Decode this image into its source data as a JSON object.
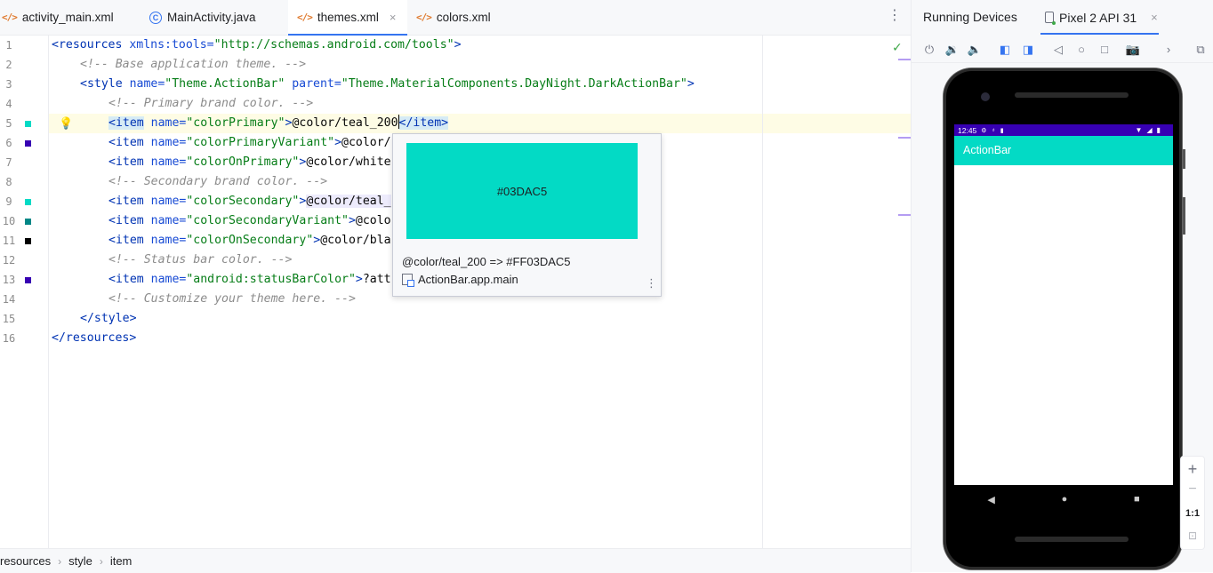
{
  "tabs": [
    {
      "label": "activity_main.xml",
      "icon": "xml-icon",
      "active": false
    },
    {
      "label": "MainActivity.java",
      "icon": "java-class-icon",
      "active": false
    },
    {
      "label": "themes.xml",
      "icon": "xml-icon",
      "active": true,
      "close": "×"
    },
    {
      "label": "colors.xml",
      "icon": "xml-icon",
      "active": false
    }
  ],
  "tab_more": "⋮",
  "editor": {
    "line_numbers": [
      "1",
      "2",
      "3",
      "4",
      "5",
      "6",
      "7",
      "8",
      "9",
      "10",
      "11",
      "12",
      "13",
      "14",
      "15",
      "16"
    ],
    "gutter_swatches": [
      {
        "line": 5,
        "color": "#03DAC5"
      },
      {
        "line": 6,
        "color": "#3700B3"
      },
      {
        "line": 9,
        "color": "#03DAC5"
      },
      {
        "line": 10,
        "color": "#018786"
      },
      {
        "line": 11,
        "color": "#000000"
      },
      {
        "line": 13,
        "color": "#3700B3"
      }
    ],
    "lines": {
      "l1": {
        "open": "<resources",
        "attr": " xmlns:tools=",
        "val": "\"http://schemas.android.com/tools\"",
        "close": ">"
      },
      "l2": {
        "comment": "<!-- Base application theme. -->"
      },
      "l3": {
        "open": "<style",
        "attr1": " name=",
        "val1": "\"Theme.ActionBar\"",
        "attr2": " parent=",
        "val2": "\"Theme.MaterialComponents.DayNight.DarkActionBar\"",
        "close": ">"
      },
      "l4": {
        "comment": "<!-- Primary brand color. -->"
      },
      "l5": {
        "open": "<item",
        "attr": " name=",
        "val": "\"colorPrimary\"",
        "gt": ">",
        "text": "@color/teal_200",
        "end": "</item>"
      },
      "l6": {
        "open": "<item",
        "attr": " name=",
        "val": "\"colorPrimaryVariant\"",
        "gt": ">",
        "text": "@color/"
      },
      "l7": {
        "open": "<item",
        "attr": " name=",
        "val": "\"colorOnPrimary\"",
        "gt": ">",
        "text": "@color/white"
      },
      "l8": {
        "comment": "<!-- Secondary brand color. -->"
      },
      "l9": {
        "open": "<item",
        "attr": " name=",
        "val": "\"colorSecondary\"",
        "gt": ">",
        "text": "@color/teal_"
      },
      "l10": {
        "open": "<item",
        "attr": " name=",
        "val": "\"colorSecondaryVariant\"",
        "gt": ">",
        "text": "@colo"
      },
      "l11": {
        "open": "<item",
        "attr": " name=",
        "val": "\"colorOnSecondary\"",
        "gt": ">",
        "text": "@color/bla"
      },
      "l12": {
        "comment": "<!-- Status bar color. -->"
      },
      "l13": {
        "open": "<item",
        "attr": " name=",
        "val": "\"android:statusBarColor\"",
        "gt": ">",
        "text": "?att"
      },
      "l14": {
        "comment": "<!-- Customize your theme here. -->"
      },
      "l15": {
        "end": "</style>"
      },
      "l16": {
        "end": "</resources>"
      }
    }
  },
  "popup": {
    "swatch_color": "#03DAC5",
    "swatch_label": "#03DAC5",
    "value_text": "@color/teal_200 => #FF03DAC5",
    "module": "ActionBar.app.main",
    "more": "⋮"
  },
  "breadcrumb": [
    "resources",
    "style",
    "item"
  ],
  "breadcrumb_sep": "›",
  "running_devices": {
    "title": "Running Devices",
    "device_tab": "Pixel 2 API 31",
    "close": "×",
    "toolbar_icons": [
      "power-icon",
      "volume-up-icon",
      "volume-down-icon",
      "rotate-left-icon",
      "rotate-right-icon",
      "back-icon",
      "home-icon",
      "overview-icon",
      "screenshot-icon",
      "more-icon",
      "device-frame-icon"
    ]
  },
  "phone": {
    "status_time": "12:45",
    "app_title": "ActionBar",
    "actionbar_color": "#03DAC5",
    "statusbar_color": "#3700B3"
  },
  "zoom": {
    "plus": "+",
    "minus": "−",
    "one_to_one": "1:1"
  }
}
